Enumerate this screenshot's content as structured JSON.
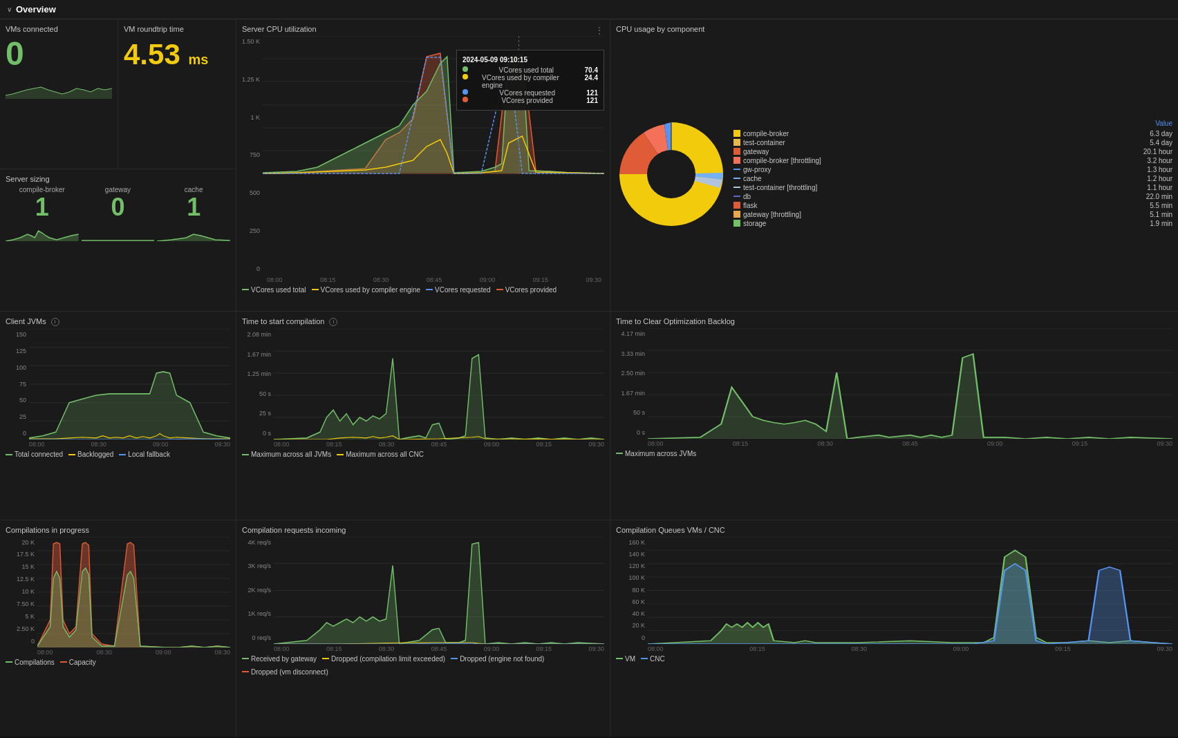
{
  "header": {
    "arrow": "∨",
    "title": "Overview"
  },
  "vms_connected": {
    "title": "VMs connected",
    "value": "0"
  },
  "vm_roundtrip": {
    "title": "VM roundtrip time",
    "value": "4.53",
    "unit": "ms"
  },
  "server_cpu": {
    "title": "Server CPU utilization",
    "y_labels": [
      "1.50 K",
      "1.25 K",
      "1 K",
      "750",
      "500",
      "250",
      "0"
    ],
    "x_labels": [
      "08:00",
      "08:15",
      "08:30",
      "08:45",
      "09:00",
      "09:15",
      "09:30"
    ],
    "legend": [
      {
        "color": "#73bf69",
        "label": "VCores used total"
      },
      {
        "color": "#f2cc0c",
        "label": "VCores used by compiler engine"
      },
      {
        "color": "#5794f2",
        "label": "VCores requested"
      },
      {
        "color": "#e05c37",
        "label": "VCores provided"
      }
    ],
    "tooltip": {
      "time": "2024-05-09 09:10:15",
      "rows": [
        {
          "label": "VCores used total",
          "value": "70.4"
        },
        {
          "label": "VCores used by compiler engine",
          "value": "24.4"
        },
        {
          "label": "VCores requested",
          "value": "121"
        },
        {
          "label": "VCores provided",
          "value": "121"
        }
      ]
    }
  },
  "cpu_usage": {
    "title": "CPU usage by component",
    "value_header": "Value",
    "items": [
      {
        "color": "#f2cc0c",
        "label": "compile-broker",
        "value": "6.3 day"
      },
      {
        "color": "#e8b84b",
        "label": "test-container",
        "value": "5.4 day"
      },
      {
        "color": "#e05c37",
        "label": "gateway",
        "value": "20.1 hour"
      },
      {
        "color": "#f37059",
        "label": "compile-broker [throttling]",
        "value": "3.2 hour"
      },
      {
        "color": "#5794f2",
        "label": "gw-proxy",
        "value": "1.3 hour"
      },
      {
        "color": "#73b0f4",
        "label": "cache",
        "value": "1.2 hour"
      },
      {
        "color": "#b0c4de",
        "label": "test-container [throttling]",
        "value": "1.1 hour"
      },
      {
        "color": "#6464c8",
        "label": "db",
        "value": "22.0 min"
      },
      {
        "color": "#e05c37",
        "label": "flask",
        "value": "5.5 min"
      },
      {
        "color": "#e8a74b",
        "label": "gateway [throttling]",
        "value": "5.1 min"
      },
      {
        "color": "#73bf69",
        "label": "storage",
        "value": "1.9 min"
      }
    ]
  },
  "server_sizing": {
    "title": "Server sizing",
    "items": [
      {
        "label": "compile-broker",
        "value": "1"
      },
      {
        "label": "gateway",
        "value": "0"
      },
      {
        "label": "cache",
        "value": "1"
      }
    ]
  },
  "client_jvms": {
    "title": "Client JVMs",
    "y_labels": [
      "150",
      "125",
      "100",
      "75",
      "50",
      "25",
      "0"
    ],
    "x_labels": [
      "08:00",
      "08:30",
      "09:00",
      "09:30"
    ],
    "legend": [
      {
        "color": "#73bf69",
        "label": "Total connected"
      },
      {
        "color": "#f2cc0c",
        "label": "Backlogged"
      },
      {
        "color": "#5794f2",
        "label": "Local fallback"
      }
    ]
  },
  "time_start": {
    "title": "Time to start compilation",
    "y_labels": [
      "2.08 min",
      "1.67 min",
      "1.25 min",
      "50 s",
      "25 s",
      "0 s"
    ],
    "x_labels": [
      "08:00",
      "08:15",
      "08:30",
      "08:45",
      "09:00",
      "09:15",
      "09:30"
    ],
    "legend": [
      {
        "color": "#73bf69",
        "label": "Maximum across all JVMs"
      },
      {
        "color": "#f2cc0c",
        "label": "Maximum across all CNC"
      }
    ]
  },
  "time_clear": {
    "title": "Time to Clear Optimization Backlog",
    "y_labels": [
      "4.17 min",
      "3.33 min",
      "2.50 min",
      "1.67 min",
      "50 s",
      "0 s"
    ],
    "x_labels": [
      "08:00",
      "08:15",
      "08:30",
      "08:45",
      "09:00",
      "09:15",
      "09:30"
    ],
    "legend": [
      {
        "color": "#73bf69",
        "label": "Maximum across JVMs"
      }
    ]
  },
  "compilations_progress": {
    "title": "Compilations in progress",
    "y_labels": [
      "20 K",
      "17.5 K",
      "15 K",
      "12.5 K",
      "10 K",
      "7.50 K",
      "5 K",
      "2.50 K",
      "0"
    ],
    "x_labels": [
      "08:00",
      "08:30",
      "09:00",
      "09:30"
    ],
    "legend": [
      {
        "color": "#73bf69",
        "label": "Compilations"
      },
      {
        "color": "#e05c37",
        "label": "Capacity"
      }
    ]
  },
  "compilation_requests": {
    "title": "Compilation requests incoming",
    "y_labels": [
      "4K req/s",
      "3K req/s",
      "2K req/s",
      "1K req/s",
      "0 req/s"
    ],
    "x_labels": [
      "08:00",
      "08:15",
      "08:30",
      "08:45",
      "09:00",
      "09:15",
      "09:30"
    ],
    "legend": [
      {
        "color": "#73bf69",
        "label": "Received by gateway"
      },
      {
        "color": "#f2cc0c",
        "label": "Dropped (compilation limit exceeded)"
      },
      {
        "color": "#5794f2",
        "label": "Dropped (engine not found)"
      },
      {
        "color": "#e05c37",
        "label": "Dropped (vm disconnect)"
      }
    ]
  },
  "compilation_queues": {
    "title": "Compilation Queues VMs / CNC",
    "y_labels": [
      "160 K",
      "140 K",
      "120 K",
      "100 K",
      "80 K",
      "60 K",
      "40 K",
      "20 K",
      "0"
    ],
    "x_labels": [
      "08:00",
      "08:15",
      "08:30",
      "09:00",
      "09:15",
      "09:30"
    ],
    "legend": [
      {
        "color": "#73bf69",
        "label": "VM"
      },
      {
        "color": "#5794f2",
        "label": "CNC"
      }
    ]
  }
}
